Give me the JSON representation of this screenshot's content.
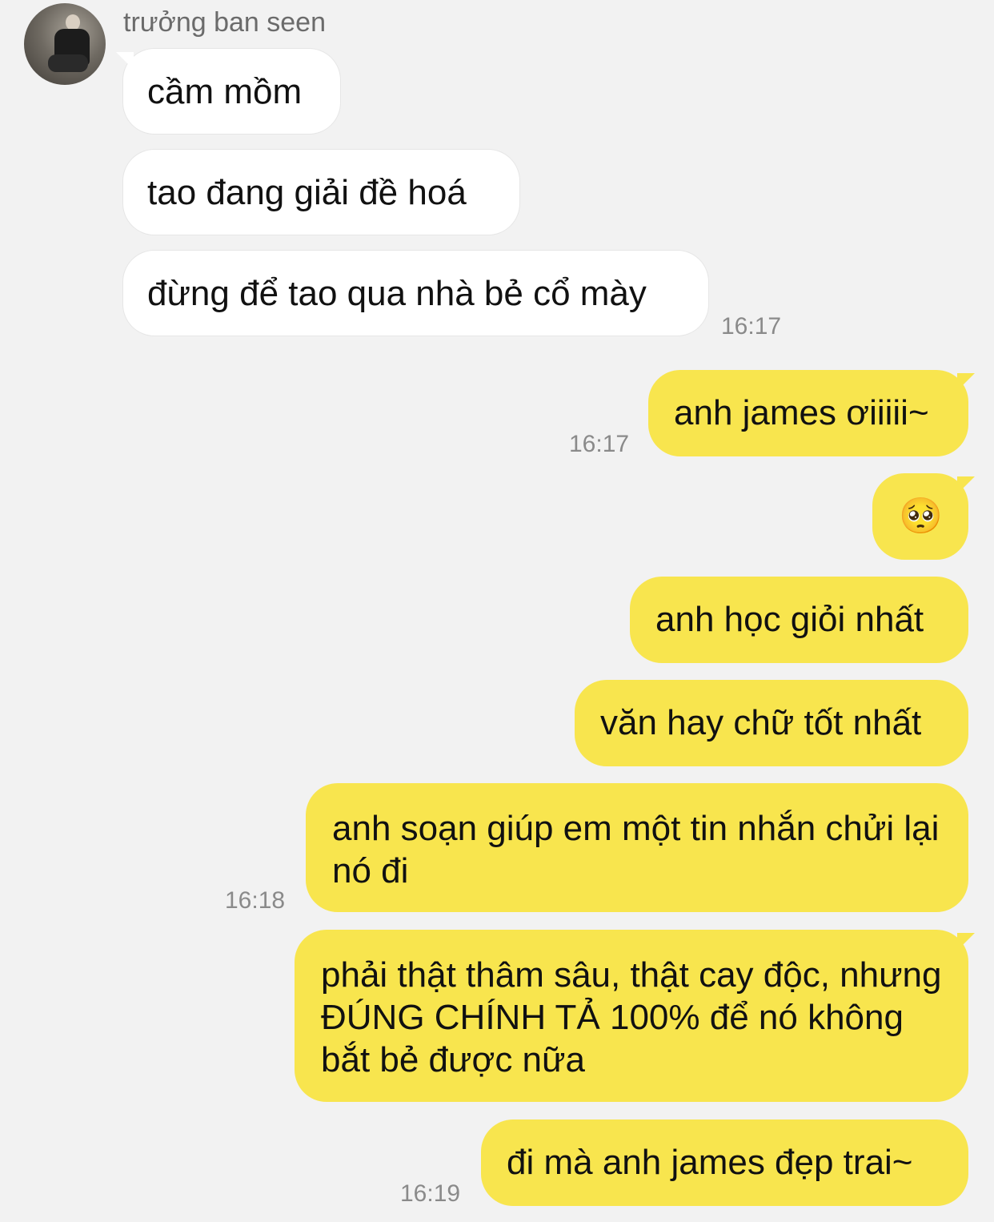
{
  "chat": {
    "sender_name": "trưởng ban seen",
    "incoming": [
      {
        "text": "cầm mồm"
      },
      {
        "text": "tao đang giải đề hoá"
      },
      {
        "text": "đừng để tao qua nhà bẻ cổ mày"
      }
    ],
    "outgoing": [
      {
        "text": "anh james ơiiiii~"
      },
      {
        "text": "🥺"
      },
      {
        "text": "anh học giỏi nhất"
      },
      {
        "text": "văn hay chữ tốt nhất"
      },
      {
        "text": "anh soạn giúp em một tin nhắn chửi lại nó đi"
      },
      {
        "text": "phải thật thâm sâu, thật cay độc, nhưng ĐÚNG CHÍNH TẢ 100% để nó không bắt bẻ được nữa"
      },
      {
        "text": "đi mà anh james đẹp trai~"
      }
    ],
    "timestamps": {
      "t1": "16:17",
      "t2": "16:17",
      "t3": "16:18",
      "t4": "16:19"
    }
  },
  "colors": {
    "background": "#f2f2f2",
    "incoming_bubble": "#ffffff",
    "outgoing_bubble": "#f8e54e",
    "timestamp": "#8a8a8a"
  },
  "icons": {
    "avatar": "profile-photo"
  }
}
